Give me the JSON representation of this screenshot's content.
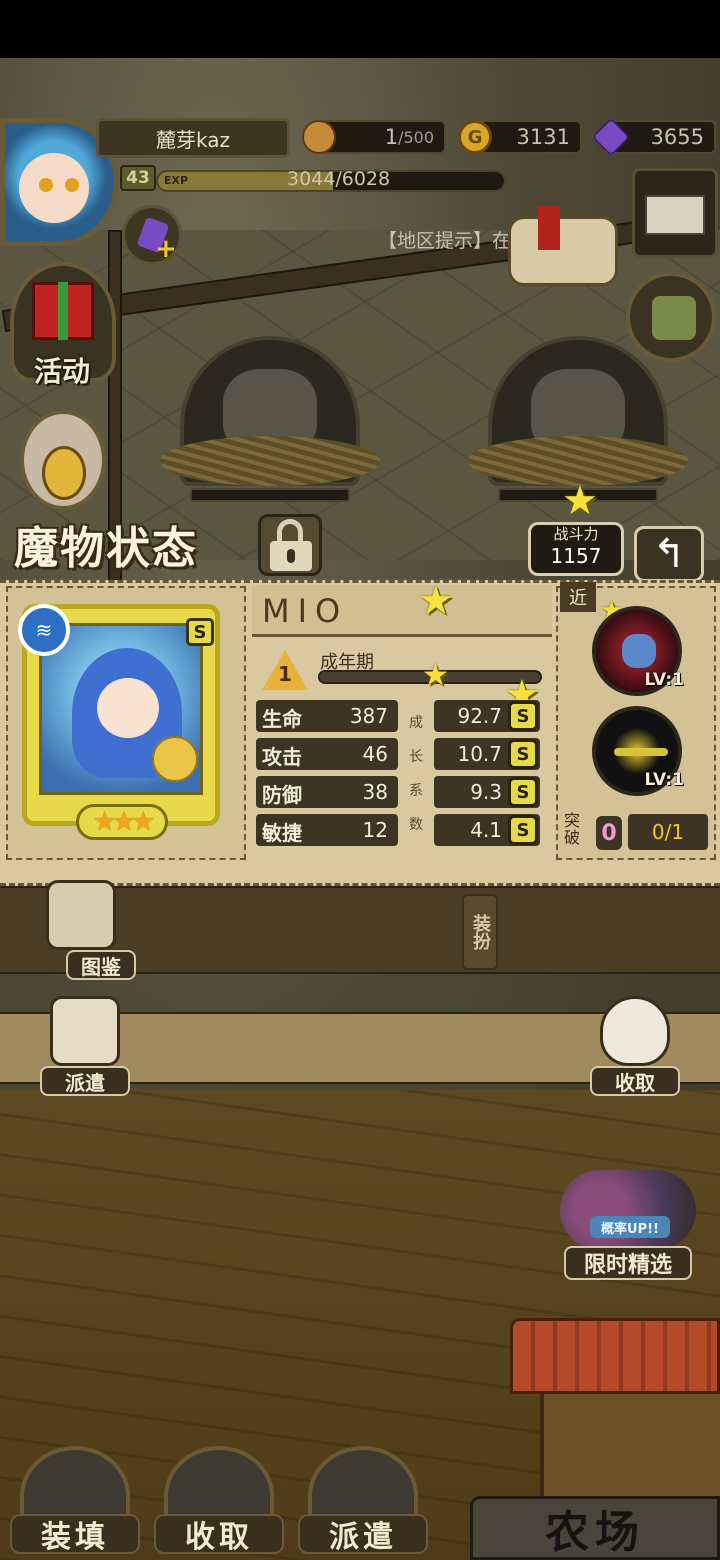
{
  "hud": {
    "player_name": "麓芽kaz",
    "level": "43",
    "exp_tag": "EXP",
    "exp_text": "3044/6028",
    "exp_fraction": 0.505,
    "stamina_current": "1",
    "stamina_max": "/500",
    "gold": "3131",
    "gems": "3655",
    "region_hint": "【地区提示】在"
  },
  "side_menu": {
    "activity_label": "活动",
    "encyclopedia_label": "图鉴",
    "dispatch_label": "派遣",
    "collect_label": "收取",
    "equip_label": "装扮"
  },
  "panel": {
    "title": "魔物状态",
    "power_label": "战斗力",
    "power_value": "1157",
    "back_glyph": "↰",
    "monster": {
      "name": "MIO",
      "element_glyph": "≋",
      "grade": "S",
      "stars": "★★★",
      "stage_num": "1",
      "stage_label": "成年期",
      "stats": [
        {
          "label": "生命",
          "value": "387",
          "growth": "92.7",
          "rank": "S"
        },
        {
          "label": "攻击",
          "value": "46",
          "growth": "10.7",
          "rank": "S"
        },
        {
          "label": "防御",
          "value": "38",
          "growth": "9.3",
          "rank": "S"
        },
        {
          "label": "敏捷",
          "value": "12",
          "growth": "4.1",
          "rank": "S"
        }
      ],
      "growth_vert_label": [
        "成",
        "长",
        "系",
        "数"
      ]
    },
    "skills": {
      "range_tag": "近",
      "skill1_level": "LV:1",
      "skill2_level": "LV:1",
      "break_label": "突破",
      "break_count": "0",
      "break_progress": "0/1"
    }
  },
  "limited": {
    "tag": "概率UP!!",
    "label": "限时精选"
  },
  "bottom": {
    "load_label": "装填",
    "collect_label": "收取",
    "dispatch_label": "派遣",
    "farm_label": "农场"
  },
  "colors": {
    "panel_bg": "#d9c9a0",
    "stat_bg": "#3e3424",
    "gold_badge": "#e8d94a",
    "break_pink": "#f09ad6"
  }
}
